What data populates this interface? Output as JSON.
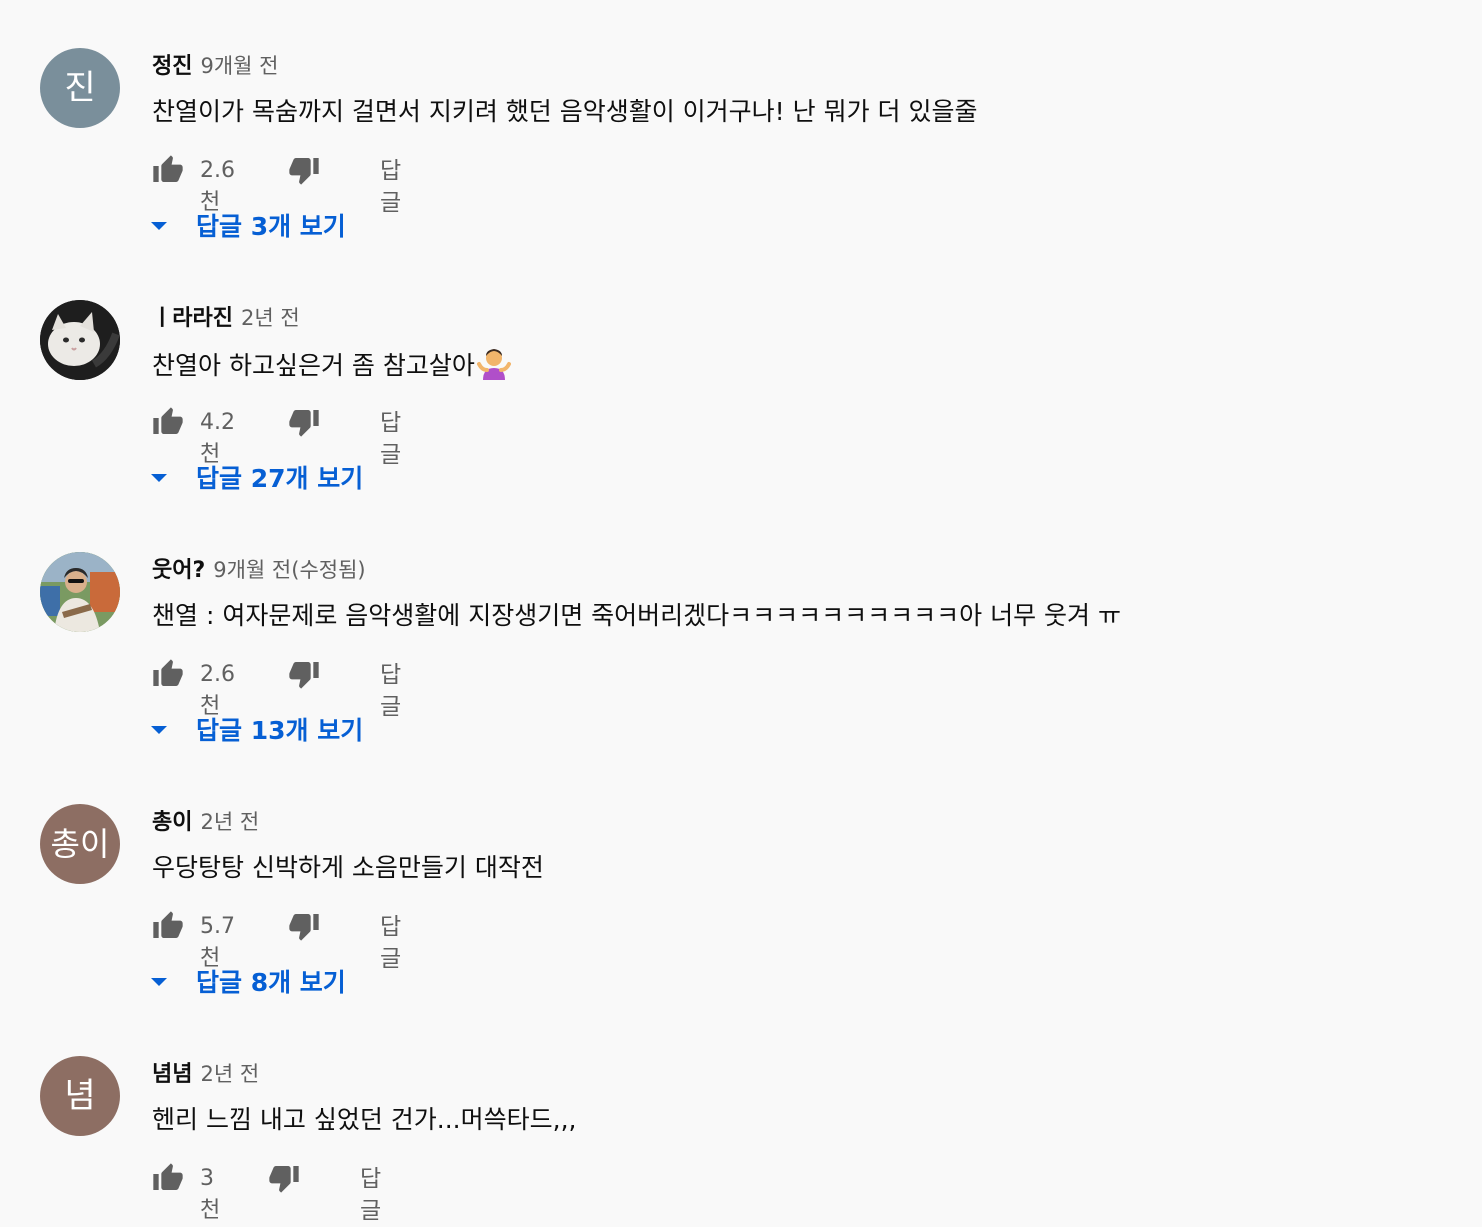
{
  "comments": [
    {
      "author": "정진",
      "time": "9개월 전",
      "avatar_initial": "진",
      "avatar_color": "#7a8f9b",
      "text": "찬열이가 목숨까지 걸면서 지키려 했던 음악생활이 이거구나! 난 뭐가 더 있을줄",
      "likes": "2.6천",
      "reply_label": "답글",
      "view_replies": "답글 3개 보기"
    },
    {
      "author": "ㅣ라라진",
      "time": "2년 전",
      "avatar_icon": "cat-photo-avatar",
      "text": "찬열아 하고싶은거 좀 참고살아",
      "emoji": "person-shrugging-emoji",
      "likes": "4.2천",
      "reply_label": "답글",
      "view_replies": "답글 27개 보기"
    },
    {
      "author": "웃어?",
      "time": "9개월 전(수정됨)",
      "avatar_icon": "person-photo-avatar",
      "text": "챈열 : 여자문제로 음악생활에 지장생기면 죽어버리겠다ㅋㅋㅋㅋㅋㅋㅋㅋㅋㅋ아 너무 웃겨 ㅠ",
      "likes": "2.6천",
      "reply_label": "답글",
      "view_replies": "답글 13개 보기"
    },
    {
      "author": "총이",
      "time": "2년 전",
      "avatar_initial": "총이",
      "avatar_color": "#8d6e63",
      "text": "우당탕탕 신박하게 소음만들기 대작전",
      "likes": "5.7천",
      "reply_label": "답글",
      "view_replies": "답글 8개 보기"
    },
    {
      "author": "념념",
      "time": "2년 전",
      "avatar_initial": "념",
      "avatar_color": "#8d6e63",
      "text": "헨리 느낌 내고 싶었던 건가...머쓱타드,,,",
      "likes": "3천",
      "reply_label": "답글"
    }
  ],
  "colors": {
    "background": "#f9f9f9",
    "link_blue": "#065fd4",
    "secondary_text": "#606060"
  }
}
